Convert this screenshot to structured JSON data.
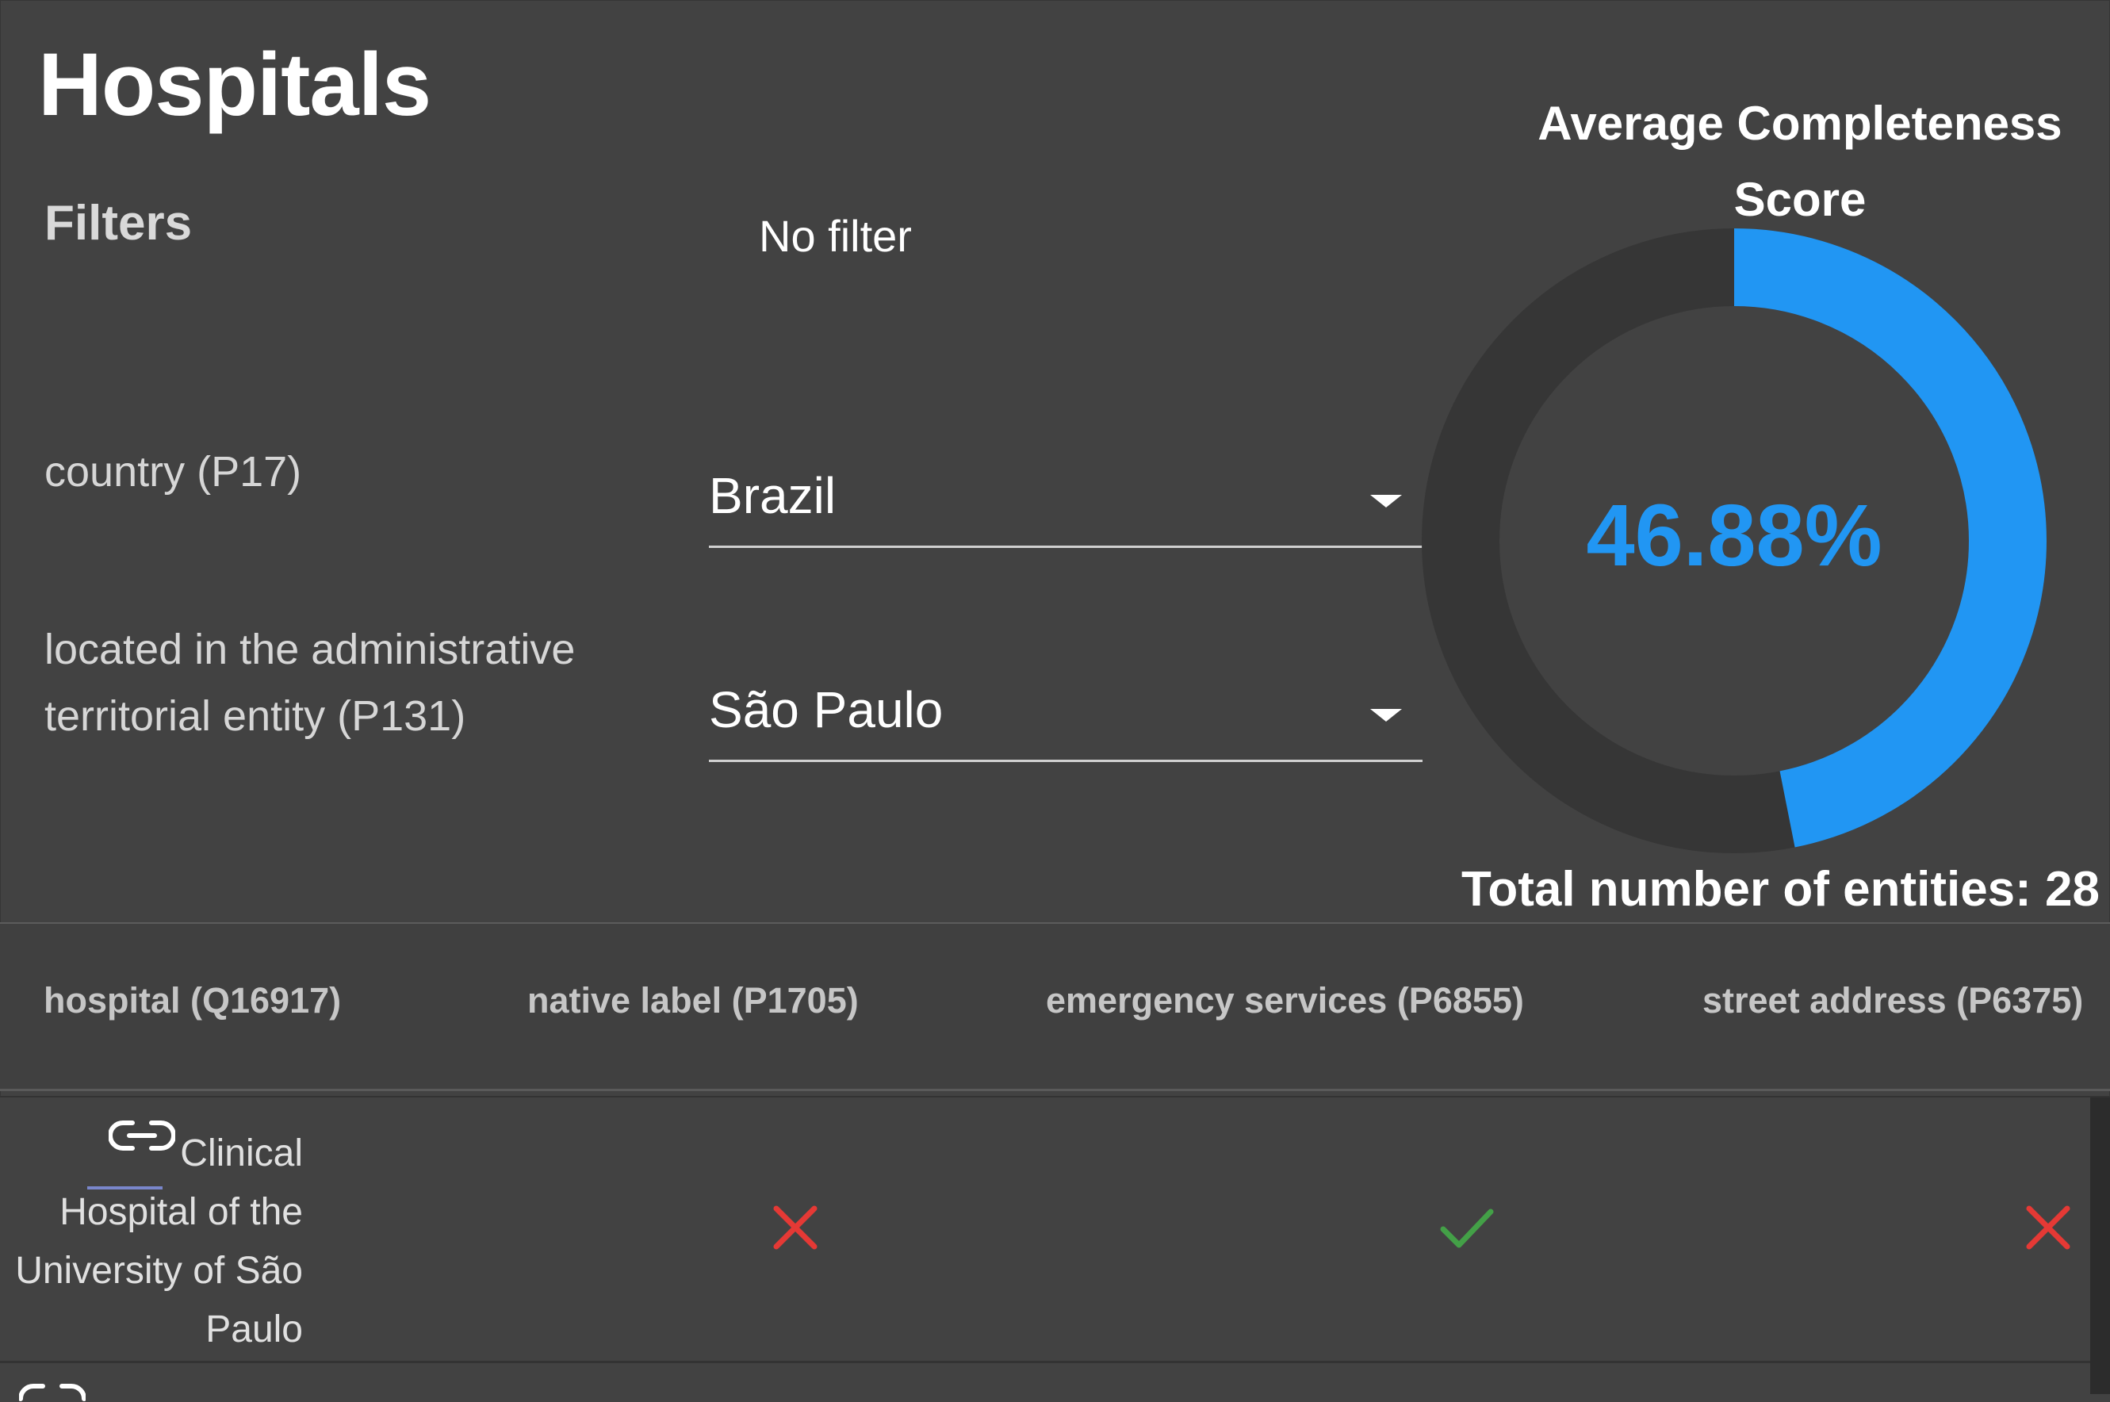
{
  "title": "Hospitals",
  "filters": {
    "heading": "Filters",
    "no_filter": "No filter",
    "items": [
      {
        "label": "country (P17)",
        "value": "Brazil"
      },
      {
        "label": "located in the administrative territorial entity (P131)",
        "value": "São Paulo"
      }
    ]
  },
  "gauge": {
    "title": "Average Completeness Score",
    "value_text": "46.88%",
    "value": 46.88,
    "accent": "#2196f3",
    "track": "#363636"
  },
  "total": "Total number of entities: 28",
  "table": {
    "columns": [
      "hospital (Q16917)",
      "native label (P1705)",
      "emergency services (P6855)",
      "street address (P6375)"
    ],
    "rows": [
      {
        "name": "Clinical Hospital of the University of São Paulo",
        "icon": "link-icon",
        "native_label": "cross-icon",
        "emergency_services": "check-icon",
        "street_address": "cross-icon"
      }
    ]
  },
  "colors": {
    "background": "#424242",
    "cross": "#e53935",
    "check": "#43a047"
  }
}
